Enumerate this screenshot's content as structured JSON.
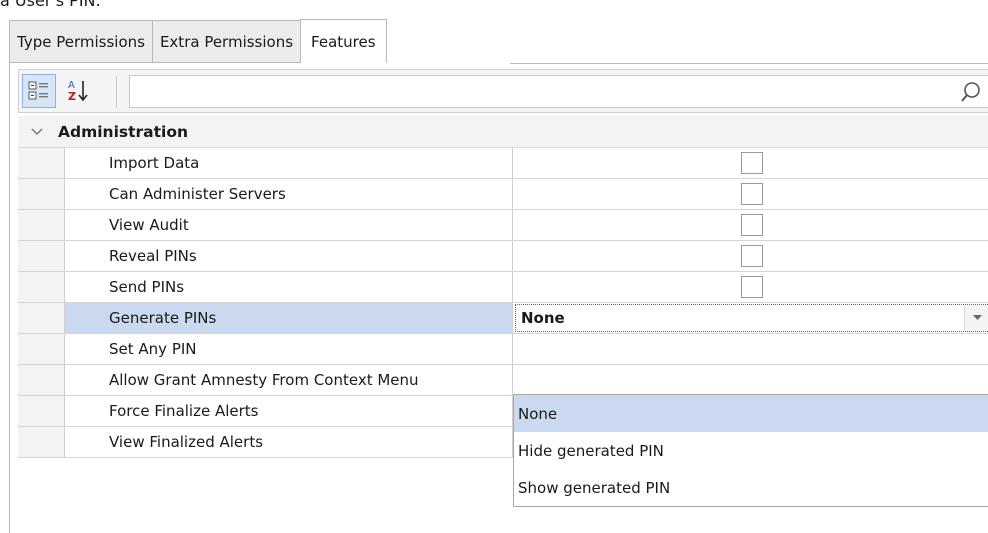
{
  "caption_fragment": "a User's PIN:",
  "tabs": [
    {
      "label": "Type Permissions",
      "active": false
    },
    {
      "label": "Extra Permissions",
      "active": false
    },
    {
      "label": "Features",
      "active": true
    }
  ],
  "toolbar": {
    "categorized_icon": "categorized-view-icon",
    "alphabetical_icon": "sort-alphabetical-icon",
    "search_value": "",
    "search_placeholder": "",
    "search_icon": "magnifier-icon"
  },
  "grid": {
    "category": {
      "label": "Administration",
      "expanded": true,
      "toggle_icon": "chevron-down-icon"
    },
    "rows": [
      {
        "name": "Import Data",
        "value_type": "checkbox",
        "checked": false
      },
      {
        "name": "Can Administer Servers",
        "value_type": "checkbox",
        "checked": false
      },
      {
        "name": "View Audit",
        "value_type": "checkbox",
        "checked": false
      },
      {
        "name": "Reveal PINs",
        "value_type": "checkbox",
        "checked": false
      },
      {
        "name": "Send PINs",
        "value_type": "checkbox",
        "checked": false
      },
      {
        "name": "Generate PINs",
        "value_type": "combo",
        "value": "None",
        "selected": true
      },
      {
        "name": "Set Any PIN",
        "value_type": "hidden"
      },
      {
        "name": "Allow Grant Amnesty From Context Menu",
        "value_type": "hidden"
      },
      {
        "name": "Force Finalize Alerts",
        "value_type": "hidden"
      },
      {
        "name": "View Finalized Alerts",
        "value_type": "checkbox",
        "checked": false
      }
    ]
  },
  "dropdown": {
    "options": [
      "None",
      "Hide generated PIN",
      "Show generated PIN"
    ],
    "highlighted": "None"
  },
  "colors": {
    "selection": "#cad9f0",
    "gutter": "#f3f3f3",
    "border": "#cfcfcf"
  }
}
